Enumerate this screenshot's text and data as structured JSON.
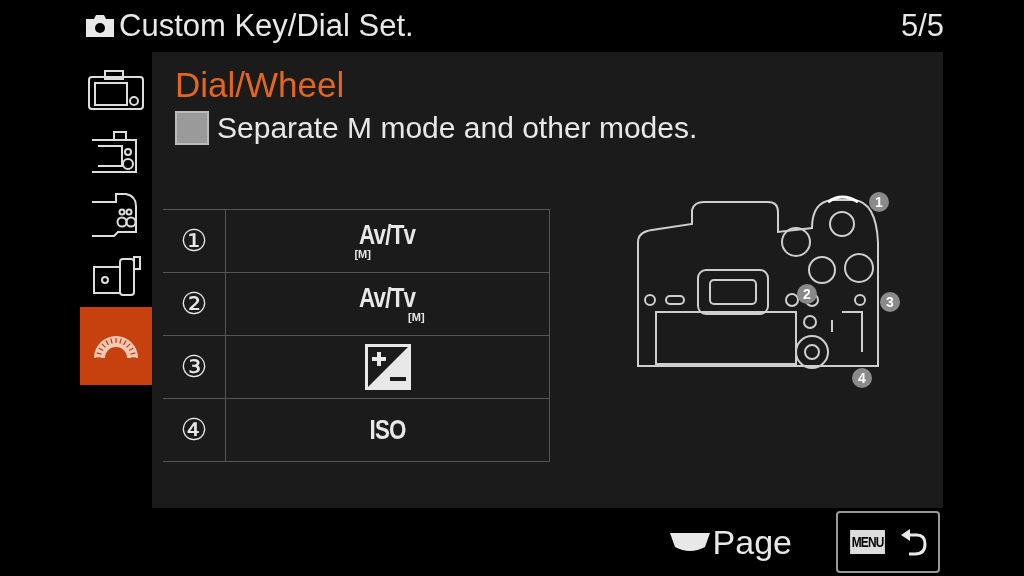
{
  "header": {
    "title": "Custom Key/Dial Set.",
    "page": "5/5"
  },
  "sidebar": {
    "items": [
      {
        "selected": false
      },
      {
        "selected": false
      },
      {
        "selected": false
      },
      {
        "selected": false
      },
      {
        "selected": true
      }
    ]
  },
  "panel": {
    "heading": "Dial/Wheel",
    "option": {
      "label": "Separate M mode and other modes.",
      "checked": false
    },
    "rows": [
      {
        "number": "①",
        "kind": "mode_sub_left",
        "main": "Av/Tv",
        "sub": "[M]"
      },
      {
        "number": "②",
        "kind": "mode_sub_right",
        "main": "Av/Tv",
        "sub": "[M]"
      },
      {
        "number": "③",
        "kind": "exposure"
      },
      {
        "number": "④",
        "kind": "text",
        "main": "ISO"
      }
    ],
    "callouts": [
      "1",
      "2",
      "3",
      "4"
    ]
  },
  "footer": {
    "page_label": "Page",
    "back_label": "MENU"
  }
}
